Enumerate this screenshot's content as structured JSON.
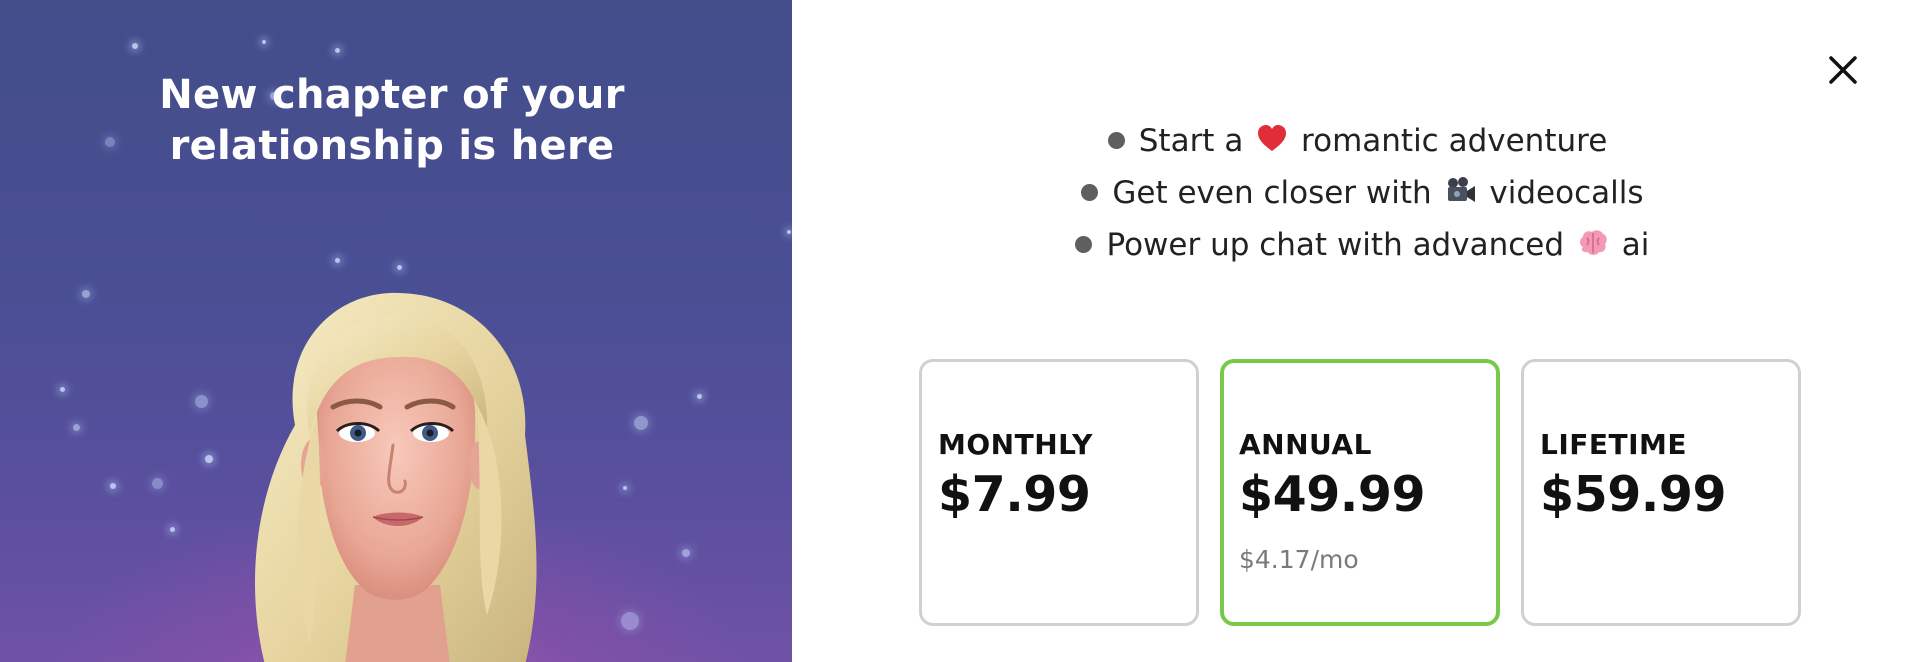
{
  "promo": {
    "title_line1": "New chapter of your",
    "title_line2": "relationship is here",
    "avatar_icon": "avatar-illustration"
  },
  "close": {
    "icon": "close-icon"
  },
  "benefits": [
    {
      "before": "Start a",
      "emoji": "heart-emoji",
      "after": "romantic adventure"
    },
    {
      "before": "Get even closer with",
      "emoji": "video-camera-emoji",
      "after": "videocalls"
    },
    {
      "before": "Power up chat with advanced",
      "emoji": "brain-emoji",
      "after": "ai"
    }
  ],
  "plans": [
    {
      "name": "MONTHLY",
      "price": "$7.99",
      "sub": "",
      "selected": false
    },
    {
      "name": "ANNUAL",
      "price": "$49.99",
      "sub": "$4.17/mo",
      "selected": true
    },
    {
      "name": "LIFETIME",
      "price": "$59.99",
      "sub": "",
      "selected": false
    }
  ],
  "colors": {
    "selected_border": "#78c94a",
    "card_border": "#d0d0d0",
    "promo_background": "#4a4f94"
  }
}
